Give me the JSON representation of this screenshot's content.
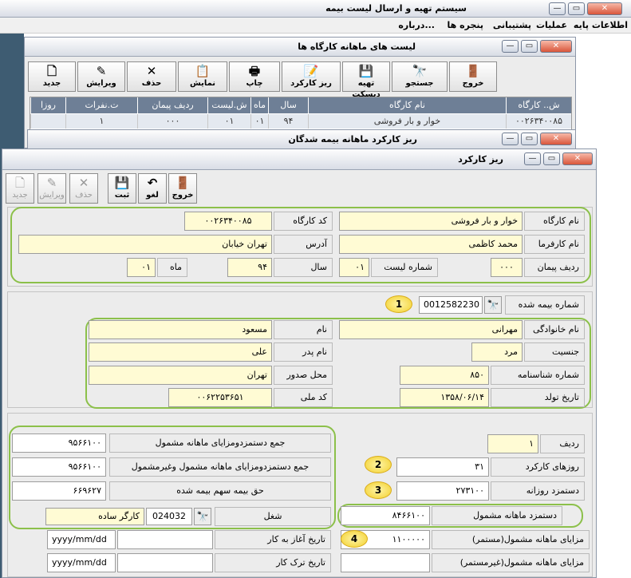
{
  "app": {
    "title": "سیستم تهیه و ارسال لیست بیمه"
  },
  "menu": [
    "اطلاعات پایه",
    "عملیات",
    "پشتیبانی",
    "پنجره ها",
    "درباره..."
  ],
  "win1": {
    "title": "لیست های ماهانه کارگاه ها",
    "toolbar": [
      {
        "key": "new",
        "label": "جدید",
        "icon": "new-file-icon",
        "glyph": "🗋"
      },
      {
        "key": "edit",
        "label": "ویرایش",
        "icon": "edit-icon",
        "glyph": "✎"
      },
      {
        "key": "delete",
        "label": "حذف",
        "icon": "delete-icon",
        "glyph": "✕"
      },
      {
        "key": "show",
        "label": "نمایش",
        "icon": "clipboard-icon",
        "glyph": "📋"
      },
      {
        "key": "print",
        "label": "چاپ",
        "icon": "printer-icon",
        "glyph": "🖶"
      },
      {
        "key": "detail",
        "label": "ریز کارکرد",
        "icon": "detail-icon",
        "glyph": "📝"
      },
      {
        "key": "disk",
        "label": "تهیه دیسکت",
        "icon": "disk-icon",
        "glyph": "💾"
      },
      {
        "key": "search",
        "label": "جستجو",
        "icon": "binoculars-icon",
        "glyph": "🔭"
      },
      {
        "key": "exit",
        "label": "خروج",
        "icon": "exit-door-icon",
        "glyph": "🚪"
      }
    ],
    "columns": [
      "ش.. کارگاه",
      "نام کارگاه",
      "سال",
      "ماه",
      "ش.لیست",
      "ردیف پیمان",
      "ت.نفرات",
      "روزا"
    ],
    "row": [
      "۰۰۲۶۳۴۰۰۸۵",
      "خوار و بار فروشی",
      "۹۴",
      "۰۱",
      "۰۱",
      "۰۰۰",
      "۱",
      ""
    ]
  },
  "win2": {
    "title": "ریز کارکرد ماهانه بیمه شدگان"
  },
  "win3": {
    "title": "ریز کارکرد",
    "toolbar": [
      {
        "key": "new",
        "label": "جدید",
        "glyph": "🗋",
        "disabled": true
      },
      {
        "key": "edit",
        "label": "ویرایش",
        "glyph": "✎",
        "disabled": true
      },
      {
        "key": "delete",
        "label": "حذف",
        "glyph": "✕",
        "disabled": true
      },
      {
        "key": "save",
        "label": "ثبت",
        "glyph": "💾",
        "disabled": false
      },
      {
        "key": "undo",
        "label": "لغو",
        "glyph": "↶",
        "disabled": false
      },
      {
        "key": "exit",
        "label": "خروج",
        "glyph": "🚪",
        "disabled": false
      }
    ]
  },
  "workshop": {
    "name_label": "نام کارگاه",
    "name": "خوار و بار فروشی",
    "code_label": "کد کارگاه",
    "code": "۰۰۲۶۳۴۰۰۸۵",
    "employer_label": "نام کارفرما",
    "employer": "محمد کاظمی",
    "address_label": "آدرس",
    "address": "تهران خیابان",
    "contract_label": "ردیف پیمان",
    "contract": "۰۰۰",
    "list_no_label": "شماره لیست",
    "list_no": "۰۱",
    "year_label": "سال",
    "year": "۹۴",
    "month_label": "ماه",
    "month": "۰۱"
  },
  "insured": {
    "number_label": "شماره بیمه شده",
    "number": "0012582230",
    "family_label": "نام خانوادگی",
    "family": "مهرانی",
    "first_label": "نام",
    "first": "مسعود",
    "gender_label": "جنسیت",
    "gender": "مرد",
    "father_label": "نام پدر",
    "father": "علی",
    "id_no_label": "شماره شناسنامه",
    "id_no": "۸۵۰",
    "issue_label": "محل صدور",
    "issue": "تهران",
    "birth_label": "تاریخ تولد",
    "birth": "۱۳۵۸/۰۶/۱۴",
    "national_label": "کد ملی",
    "national": "۰۰۶۲۲۵۳۶۵۱"
  },
  "work": {
    "row_label": "ردیف",
    "row": "۱",
    "days_label": "روزهای کارکرد",
    "days": "۳۱",
    "daily_label": "دستمزد روزانه",
    "daily": "۲۷۳۱۰۰",
    "monthly_label": "دستمزد ماهانه مشمول",
    "monthly": "۸۴۶۶۱۰۰",
    "benefit_label": "مزایای ماهانه مشمول(مستمر)",
    "benefit": "۱۱۰۰۰۰۰",
    "benefit2_label": "مزایای ماهانه مشمول(غیرمستمر)",
    "benefit2": "",
    "sum1_label": "جمع دستمزدومزایای ماهانه مشمول",
    "sum1": "۹۵۶۶۱۰۰",
    "sum2_label": "جمع دستمزدومزایای ماهانه مشمول وغیرمشمول",
    "sum2": "۹۵۶۶۱۰۰",
    "share_label": "حق بیمه سهم بیمه شده",
    "share": "۶۶۹۶۲۷",
    "job_label": "شغل",
    "job_code": "024032",
    "job": "کارگر ساده",
    "start_label": "تاریخ آغاز به کار",
    "start": "",
    "end_label": "تاریخ ترک کار",
    "end": "",
    "date_ph": "yyyy/mm/dd"
  },
  "badges": [
    "1",
    "2",
    "3",
    "4"
  ],
  "colors": {
    "field": "#fffbd4",
    "highlight": "#8cc04a",
    "badge": "#f2cf2a"
  }
}
